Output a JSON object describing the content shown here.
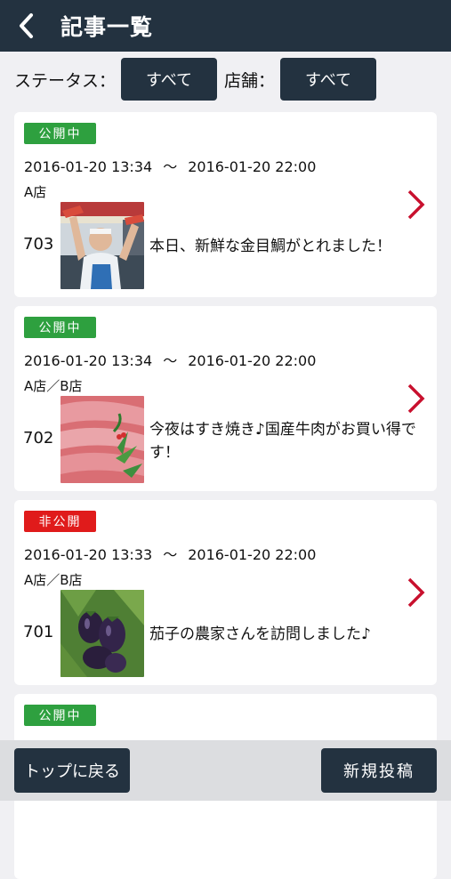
{
  "header": {
    "title": "記事一覧"
  },
  "filter": {
    "status_label": "ステータス：",
    "status_value": "すべて",
    "store_label": "店舗：",
    "store_value": "すべて"
  },
  "articles": [
    {
      "status": "公開中",
      "period_start": "2016-01-20 13:34",
      "tilde": "～",
      "period_end": "2016-01-20 22:00",
      "stores": "A店",
      "id": "703",
      "title": "本日、新鮮な金目鯛がとれました！"
    },
    {
      "status": "公開中",
      "period_start": "2016-01-20 13:34",
      "tilde": "～",
      "period_end": "2016-01-20 22:00",
      "stores": "A店／B店",
      "id": "702",
      "title": "今夜はすき焼き♪国産牛肉がお買い得です！"
    },
    {
      "status": "非公開",
      "period_start": "2016-01-20 13:33",
      "tilde": "～",
      "period_end": "2016-01-20 22:00",
      "stores": "A店／B店",
      "id": "701",
      "title": "茄子の農家さんを訪問しました♪"
    },
    {
      "status": "公開中"
    }
  ],
  "footer": {
    "top_label": "トップに戻る",
    "new_post_label": "新規投稿"
  },
  "colors": {
    "navy": "#233240",
    "public": "#2ea03f",
    "private": "#e01b1b",
    "chevron": "#c8102e"
  }
}
